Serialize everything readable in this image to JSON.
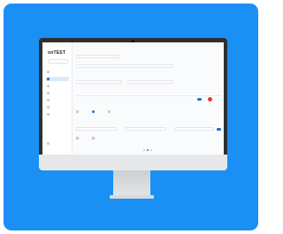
{
  "sidebar": {
    "logo": "onTEST",
    "user_select": "",
    "items": [
      {
        "label": ""
      },
      {
        "label": ""
      },
      {
        "label": ""
      },
      {
        "label": ""
      },
      {
        "label": ""
      },
      {
        "label": ""
      },
      {
        "label": ""
      }
    ],
    "active_index": 1,
    "logout_label": ""
  },
  "main": {
    "page_title": "",
    "fields": {
      "field_1_label": "",
      "field_1_value": "",
      "field_2_label": "",
      "field_2_value": "",
      "field_3_label": "",
      "field_3_value": "",
      "field_4_label": "",
      "field_4_value": ""
    },
    "table": {
      "headers": [
        "",
        "",
        "",
        "",
        "",
        ""
      ],
      "row": [
        "",
        "",
        "",
        ""
      ]
    },
    "options": {
      "group_label": "",
      "radio_1": "",
      "radio_2": "",
      "radio_3": ""
    },
    "bottom": {
      "label_1": "",
      "value_1": "",
      "label_2": "",
      "value_2": "",
      "label_3": "",
      "value_3": "",
      "check_1": "",
      "check_2": ""
    },
    "pagination": {
      "pages": 3,
      "current": 2
    }
  },
  "colors": {
    "background": "#1a90f5",
    "accent": "#1a6fd8",
    "danger": "#e53935"
  }
}
